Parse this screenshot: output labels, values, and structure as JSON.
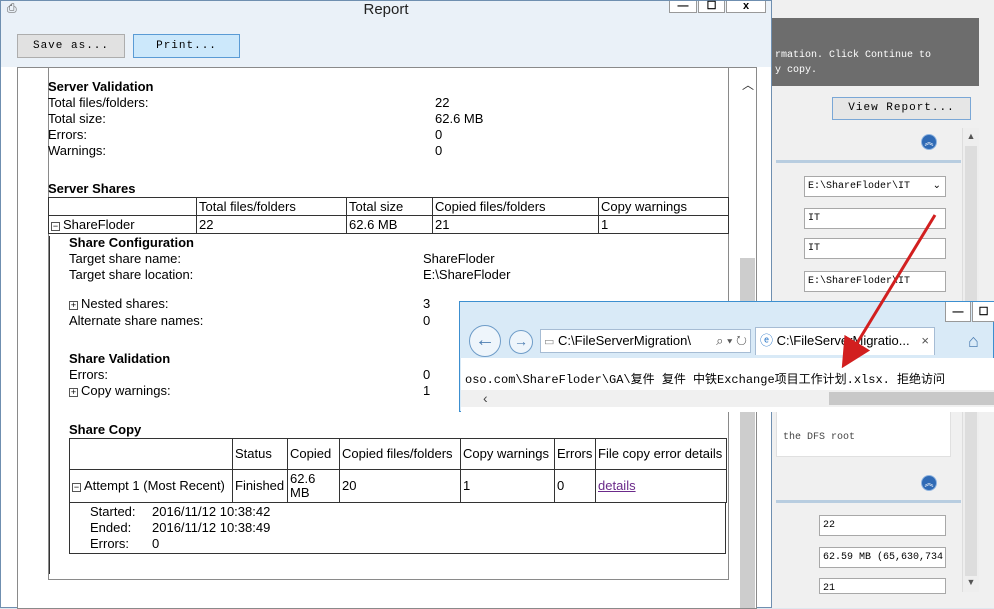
{
  "report": {
    "title": "Report",
    "buttons": {
      "save_as": "Save as...",
      "print": "Print..."
    },
    "window_buttons": {
      "minimize": "—",
      "maximize": "☐",
      "close": "x"
    },
    "server_validation": {
      "heading": "Server Validation",
      "rows": [
        {
          "label": "Total files/folders:",
          "value": "22"
        },
        {
          "label": "Total size:",
          "value": "62.6 MB"
        },
        {
          "label": "Errors:",
          "value": "0"
        },
        {
          "label": "Warnings:",
          "value": "0"
        }
      ]
    },
    "server_shares": {
      "heading": "Server Shares",
      "columns": [
        "",
        "Total files/folders",
        "Total size",
        "Copied files/folders",
        "Copy warnings"
      ],
      "row": {
        "toggle": "−",
        "name": "ShareFloder",
        "total_files": "22",
        "total_size": "62.6 MB",
        "copied": "21",
        "warnings": "1"
      }
    },
    "share_configuration": {
      "heading": "Share Configuration",
      "rows": [
        {
          "label": "Target share name:",
          "value": "ShareFloder"
        },
        {
          "label": "Target share location:",
          "value": "E:\\ShareFloder"
        }
      ],
      "nested": {
        "toggle": "+",
        "label": "Nested shares:",
        "value": "3"
      },
      "alternate": {
        "label": "Alternate share names:",
        "value": "0"
      }
    },
    "share_validation": {
      "heading": "Share Validation",
      "errors": {
        "label": "Errors:",
        "value": "0"
      },
      "warnings": {
        "toggle": "+",
        "label": "Copy warnings:",
        "value": "1"
      }
    },
    "share_copy": {
      "heading": "Share Copy",
      "columns": [
        "",
        "Status",
        "Copied",
        "Copied files/folders",
        "Copy warnings",
        "Errors",
        "File copy error details"
      ],
      "row": {
        "toggle": "−",
        "attempt": "Attempt 1 (Most Recent)",
        "status": "Finished",
        "copied": "62.6 MB",
        "files": "20",
        "warnings": "1",
        "errors": "0",
        "details": "details"
      },
      "detail": [
        {
          "label": "Started:",
          "value": "2016/11/12 10:38:42"
        },
        {
          "label": "Ended:",
          "value": "2016/11/12 10:38:49"
        },
        {
          "label": "Errors:",
          "value": "0"
        }
      ]
    }
  },
  "browser": {
    "address": "C:\\FileServerMigration\\",
    "tab_title": "C:\\FileServerMigratio...",
    "tab_close": "×",
    "message": "oso.com\\ShareFloder\\GA\\复件  复件  中铁Exchange项目工作计划.xlsx.  拒绝访问",
    "window_buttons": {
      "minimize": "—",
      "maximize": "☐"
    }
  },
  "wizard": {
    "header_text_1": "rmation. Click Continue to",
    "header_text_2": "y copy.",
    "view_report": "View Report...",
    "target_location": "E:\\ShareFloder\\IT",
    "share_name_1": "IT",
    "share_name_2": "IT",
    "folder_path": "E:\\ShareFloder\\IT",
    "dfs_text": "the DFS root",
    "files_value": "22",
    "size_value": "62.59 MB (65,630,734",
    "copied_value": "21"
  }
}
